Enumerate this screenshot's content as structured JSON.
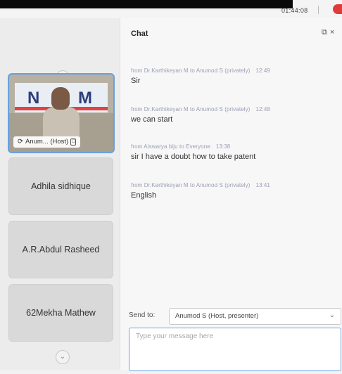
{
  "topbar": {
    "clock": "01:44:08"
  },
  "participants": {
    "video_tile": {
      "banner_text_left": "N",
      "banner_text_right": "M",
      "name": "Anum...",
      "role": "(Host)"
    },
    "tiles": [
      {
        "name": "Adhila sidhique"
      },
      {
        "name": "A.R.Abdul Rasheed"
      },
      {
        "name": "62Mekha Mathew"
      }
    ]
  },
  "chat": {
    "title": "Chat",
    "messages": [
      {
        "meta": "from Dr.Karthikeyan M to Anumod S (privately)",
        "time": "12:49",
        "text": "Sir"
      },
      {
        "meta": "from Dr.Karthikeyan M to Anumod S (privately)",
        "time": "12:48",
        "text": "we can start"
      },
      {
        "meta": "from Aiswarya biju to Everyone",
        "time": "13:38",
        "text": "sir I have a doubt how to take patent"
      },
      {
        "meta": "from Dr.Karthikeyan M to Anumod S (privately)",
        "time": "13:41",
        "text": "English"
      }
    ],
    "send_to_label": "Send to:",
    "send_to_value": "Anumod S (Host, presenter)",
    "input_placeholder": "Type your message here"
  },
  "colors": {
    "accent_border": "#6aa0dc",
    "record_red": "#e03b3b"
  },
  "icons": {
    "scroll_up": "chevron-up-icon",
    "scroll_down": "chevron-down-icon",
    "popout": "popout-icon",
    "close": "close-icon",
    "dropdown": "chevron-down-icon"
  }
}
